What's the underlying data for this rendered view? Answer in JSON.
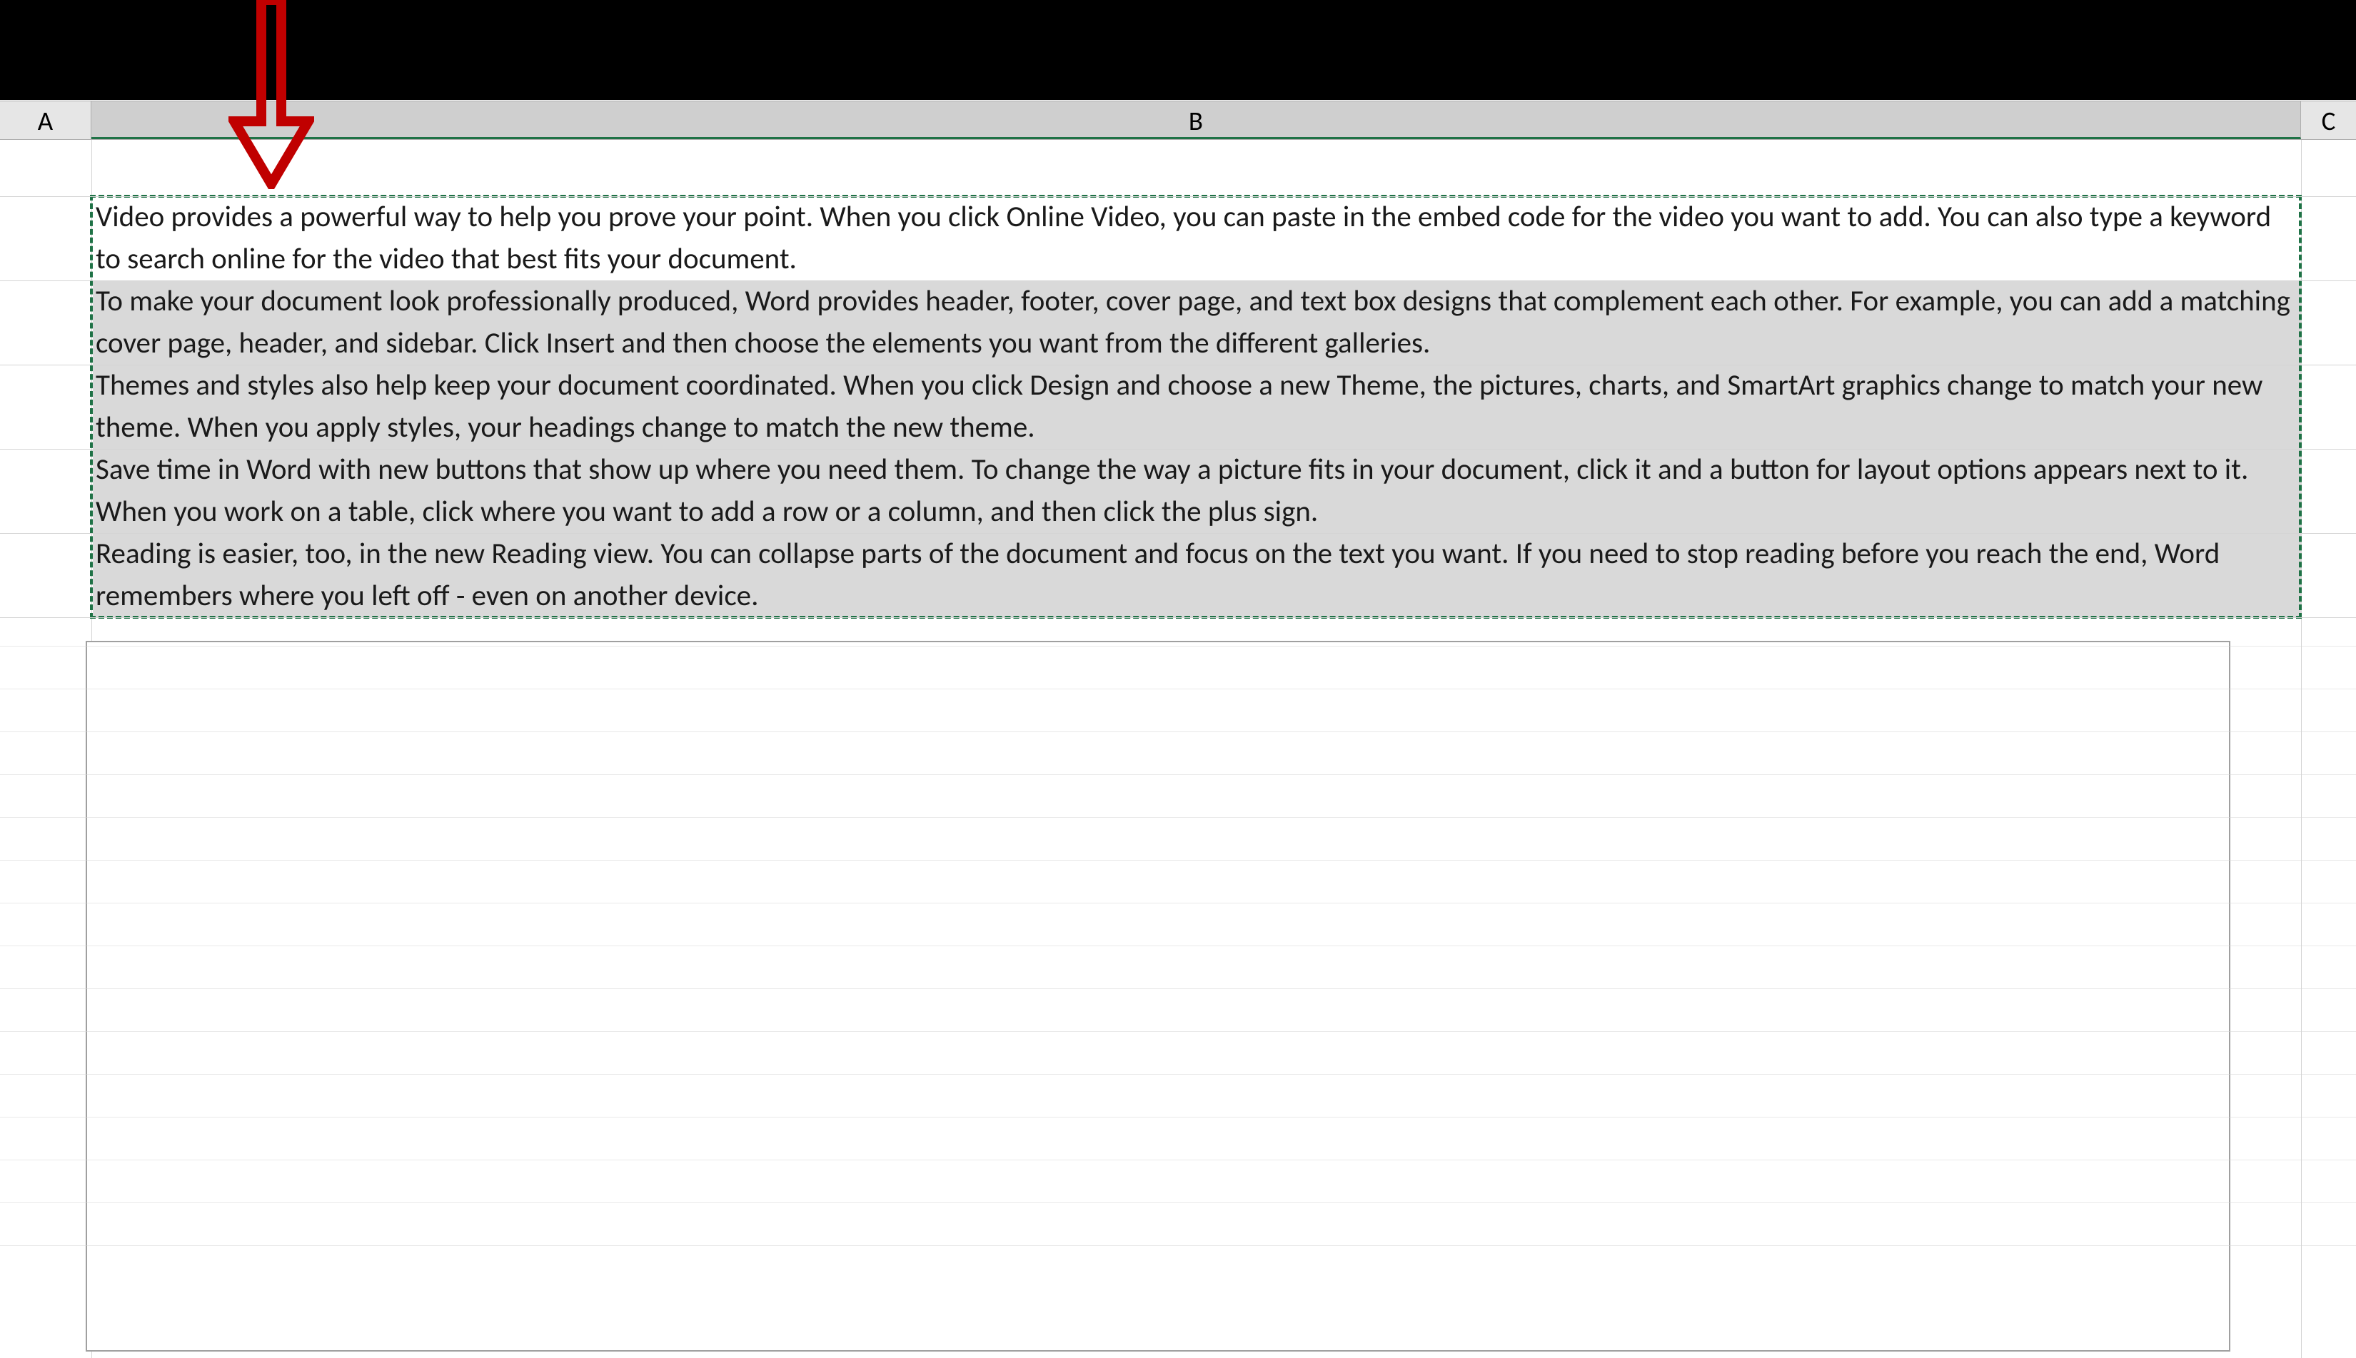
{
  "columns": {
    "A": "A",
    "B": "B",
    "C": "C"
  },
  "rows": [
    {
      "text": "Video provides a powerful way to help you prove your point. When you click Online Video, you can paste in the embed code for the video you want to add. You can also type a keyword to search online for the video that best fits your document.",
      "shaded": false
    },
    {
      "text": "To make your document look professionally produced, Word provides header, footer, cover page, and text box designs that complement each other. For example, you can add a matching cover page, header, and sidebar. Click Insert and then choose the elements you want from the different galleries.",
      "shaded": true
    },
    {
      "text": "Themes and styles also help keep your document coordinated. When you click Design and choose a new Theme, the pictures, charts, and SmartArt graphics change to match your new theme. When you apply styles, your headings change to match the new theme.",
      "shaded": true
    },
    {
      "text": "Save time in Word with new buttons that show up where you need them. To change the way a picture fits in your document, click it and a button for layout options appears next to it. When you work on a table, click where you want to add a row or a column, and then click the plus sign.",
      "shaded": true
    },
    {
      "text": "Reading is easier, too, in the new Reading view. You can collapse parts of the document and focus on the text you want. If you need to stop reading before you reach the end, Word remembers where you left off - even on another device.",
      "shaded": true
    }
  ],
  "annotation": {
    "arrow_color": "#c00000"
  }
}
